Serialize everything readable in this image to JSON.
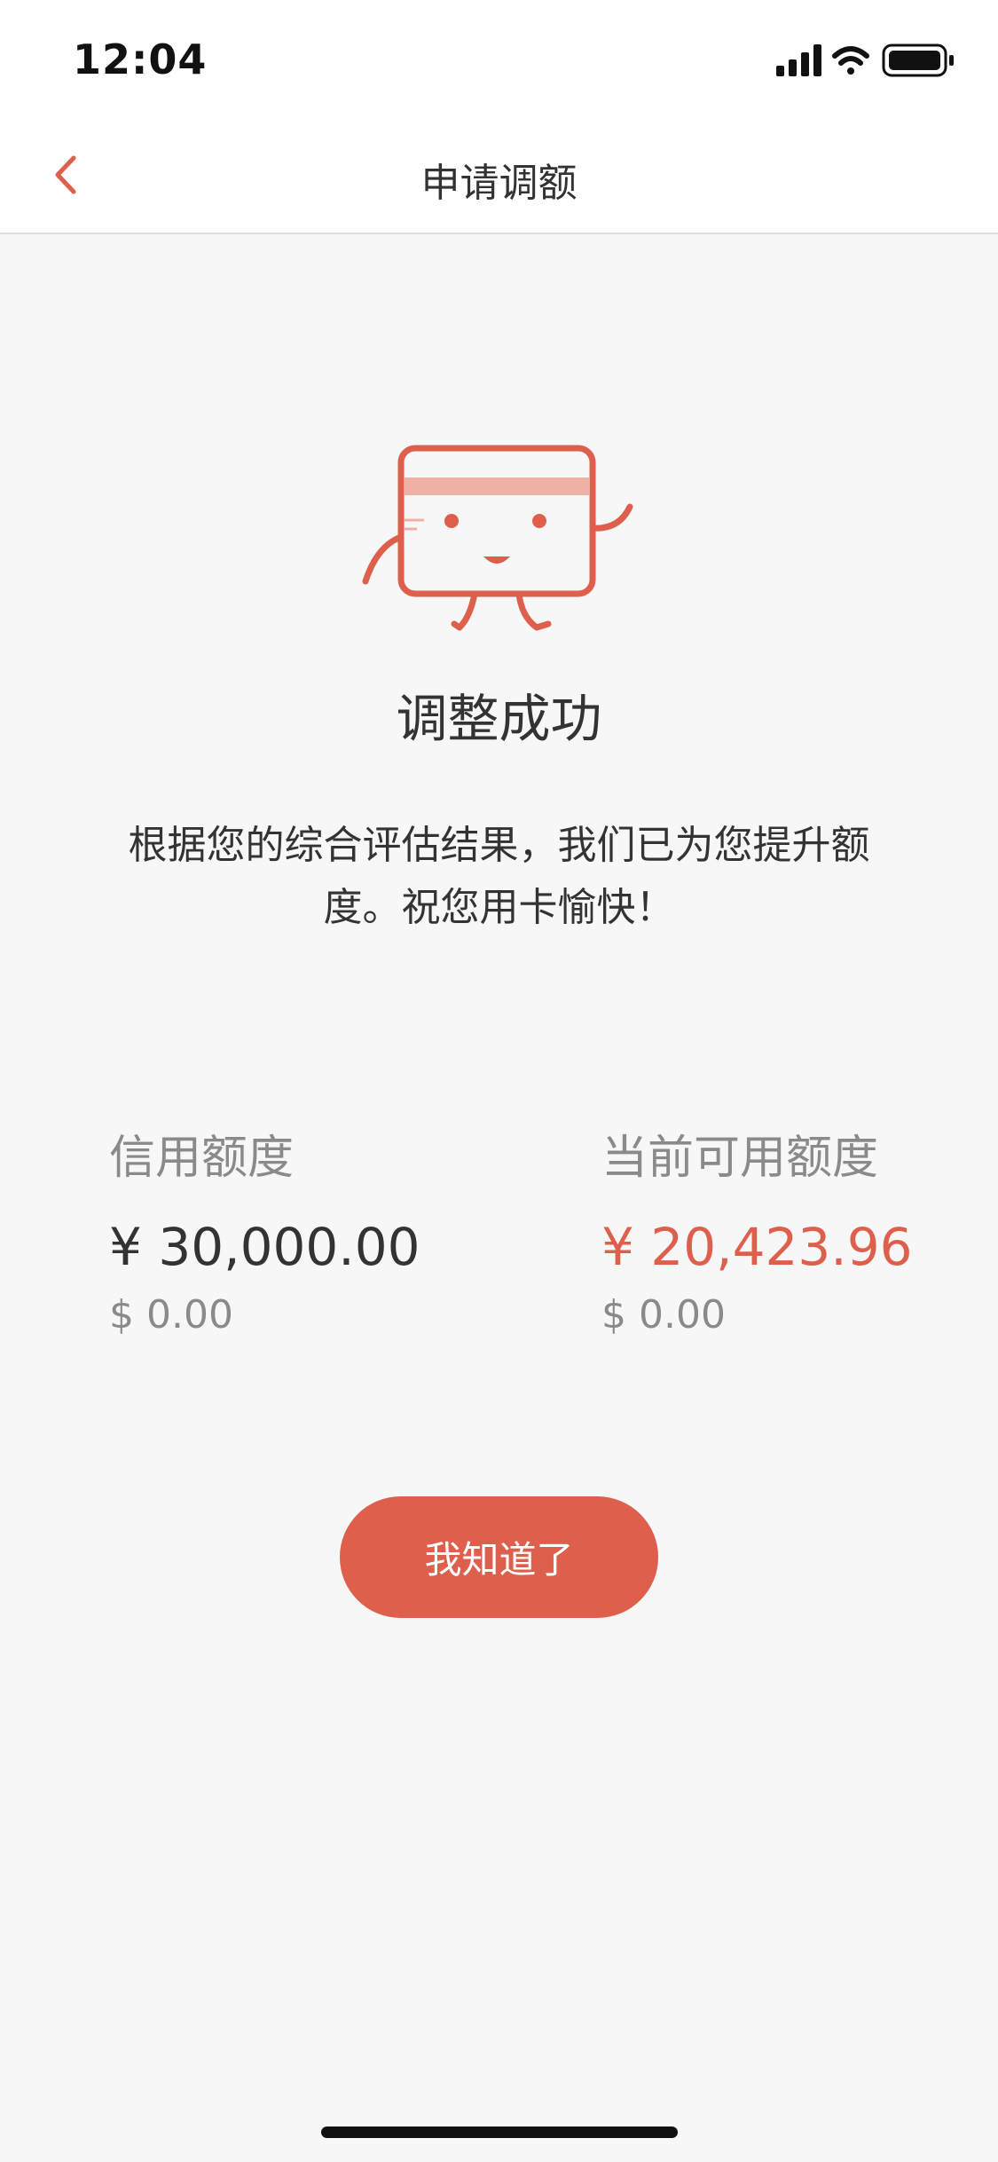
{
  "status_bar": {
    "time": "12:04",
    "icons": [
      "signal-icon",
      "wifi-icon",
      "battery-icon"
    ]
  },
  "nav": {
    "title": "申请调额",
    "back_icon": "chevron-left-icon"
  },
  "result": {
    "icon": "card-mascot-icon",
    "title": "调整成功",
    "description": "根据您的综合评估结果，我们已为您提升额度。祝您用卡愉快！"
  },
  "limits": {
    "credit": {
      "label": "信用额度",
      "value": "¥ 30,000.00",
      "usd": "$ 0.00"
    },
    "available": {
      "label": "当前可用额度",
      "value": "¥ 20,423.96",
      "usd": "$ 0.00"
    }
  },
  "actions": {
    "confirm_label": "我知道了"
  },
  "colors": {
    "accent": "#de5f4c",
    "background": "#f7f7f7",
    "text": "#333333",
    "secondary_text": "#8a8a8a"
  }
}
